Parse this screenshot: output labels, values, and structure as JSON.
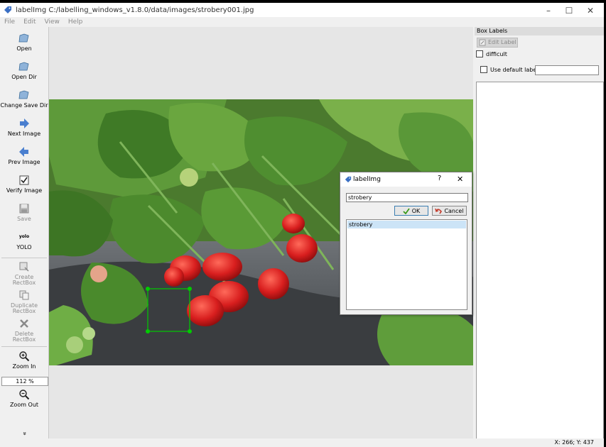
{
  "window": {
    "title": "labelImg C:/labelling_windows_v1.8.0/data/images/strobery001.jpg",
    "controls": [
      "–",
      "☐",
      "✕"
    ]
  },
  "menu": [
    "File",
    "Edit",
    "View",
    "Help"
  ],
  "toolbar": {
    "open": "Open",
    "open_dir": "Open Dir",
    "change_save_dir": "Change Save Dir",
    "next_image": "Next Image",
    "prev_image": "Prev Image",
    "verify_image": "Verify Image",
    "save": "Save",
    "yolo_icon_text": "yolo",
    "yolo": "YOLO",
    "create_rectbox_1": "Create",
    "create_rectbox_2": "RectBox",
    "duplicate_rectbox_1": "Duplicate",
    "duplicate_rectbox_2": "RectBox",
    "delete_rectbox_1": "Delete",
    "delete_rectbox_2": "RectBox",
    "zoom_in": "Zoom In",
    "zoom_value": "112 %",
    "zoom_out": "Zoom Out",
    "more": "»"
  },
  "side_panel": {
    "title": "Box Labels",
    "edit_label": "Edit Label",
    "difficult": "difficult",
    "use_default_label": "Use default label",
    "default_label_value": ""
  },
  "dialog": {
    "title": "labelImg",
    "help": "?",
    "close": "✕",
    "input_value": "strobery",
    "ok": "OK",
    "cancel": "Cancel",
    "items": [
      "strobery"
    ]
  },
  "status": {
    "coords": "X: 266; Y: 437"
  },
  "colors": {
    "bbox": "#00cc00",
    "selection": "#cce4f7",
    "ok_border": "#3c7fb1"
  }
}
